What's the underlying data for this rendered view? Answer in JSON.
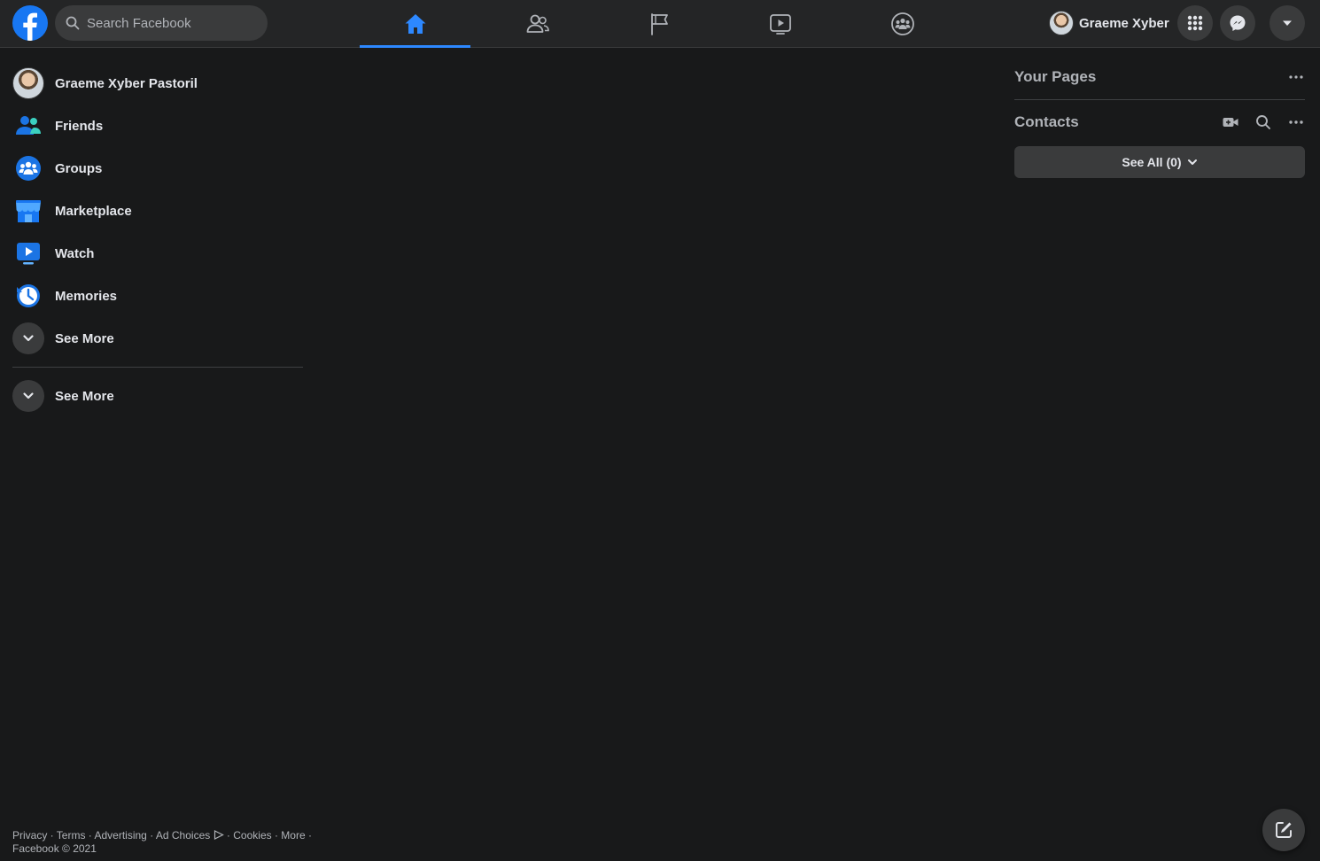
{
  "header": {
    "search": {
      "placeholder": "Search Facebook"
    },
    "profile_name": "Graeme Xyber",
    "tabs": [
      {
        "name": "home",
        "icon": "home-icon",
        "active": true
      },
      {
        "name": "friends",
        "icon": "friends-icon",
        "active": false
      },
      {
        "name": "pages",
        "icon": "flag-icon",
        "active": false
      },
      {
        "name": "watch",
        "icon": "video-icon",
        "active": false
      },
      {
        "name": "groups",
        "icon": "groups-icon",
        "active": false
      }
    ]
  },
  "sidebar": {
    "items": [
      {
        "label": "Graeme Xyber Pastoril",
        "icon": "avatar"
      },
      {
        "label": "Friends",
        "icon": "friends-icon"
      },
      {
        "label": "Groups",
        "icon": "groups-icon"
      },
      {
        "label": "Marketplace",
        "icon": "marketplace-icon"
      },
      {
        "label": "Watch",
        "icon": "watch-icon"
      },
      {
        "label": "Memories",
        "icon": "memories-icon"
      },
      {
        "label": "See More",
        "icon": "chevron-down-icon"
      }
    ],
    "shortcuts_see_more": "See More"
  },
  "footer": {
    "privacy": "Privacy",
    "terms": "Terms",
    "advertising": "Advertising",
    "ad_choices": "Ad Choices",
    "cookies": "Cookies",
    "more": "More",
    "copyright": "Facebook © 2021"
  },
  "right": {
    "your_pages_title": "Your Pages",
    "contacts_title": "Contacts",
    "see_all_label": "See All (0)"
  },
  "colors": {
    "background": "#18191a",
    "surface": "#242526",
    "accent": "#2d88ff",
    "brand": "#1877f2"
  }
}
